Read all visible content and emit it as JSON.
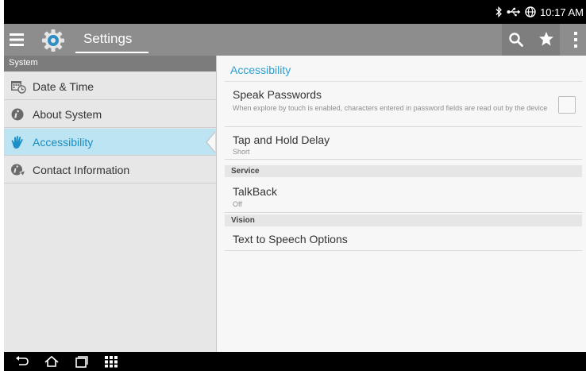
{
  "status_bar": {
    "clock": "10:17 AM",
    "icons": [
      "bluetooth-icon",
      "usb-icon",
      "globe-icon"
    ]
  },
  "action_bar": {
    "title": "Settings",
    "icons": [
      "menu-icon",
      "settings-gear-icon",
      "search-icon",
      "star-icon",
      "more-vert-icon"
    ]
  },
  "sidebar": {
    "header": "System",
    "items": [
      {
        "label": "Date & Time",
        "icon": "calendar-clock-icon"
      },
      {
        "label": "About System",
        "icon": "info-icon"
      },
      {
        "label": "Accessibility",
        "icon": "hand-icon",
        "selected": true
      },
      {
        "label": "Contact Information",
        "icon": "contact-info-icon"
      }
    ]
  },
  "content": {
    "title": "Accessibility",
    "rows": [
      {
        "title": "Speak Passwords",
        "subtitle": "When explore by touch is enabled, characters entered in password fields are read out by the device",
        "checked": false
      },
      {
        "title": "Tap and Hold Delay",
        "subtitle": "Short"
      }
    ],
    "sections": [
      {
        "header": "Service",
        "rows": [
          {
            "title": "TalkBack",
            "subtitle": "Off"
          }
        ]
      },
      {
        "header": "Vision",
        "rows": [
          {
            "title": "Text to Speech Options"
          }
        ]
      }
    ]
  },
  "nav_bar": {
    "icons": [
      "back-icon",
      "home-icon",
      "recent-apps-icon",
      "apps-grid-icon"
    ]
  },
  "colors": {
    "accent": "#2a9fd1",
    "selected_bg": "#bce4f3",
    "action_bar": "#8d8d8d",
    "sidebar_bg": "#e7e7e7"
  }
}
